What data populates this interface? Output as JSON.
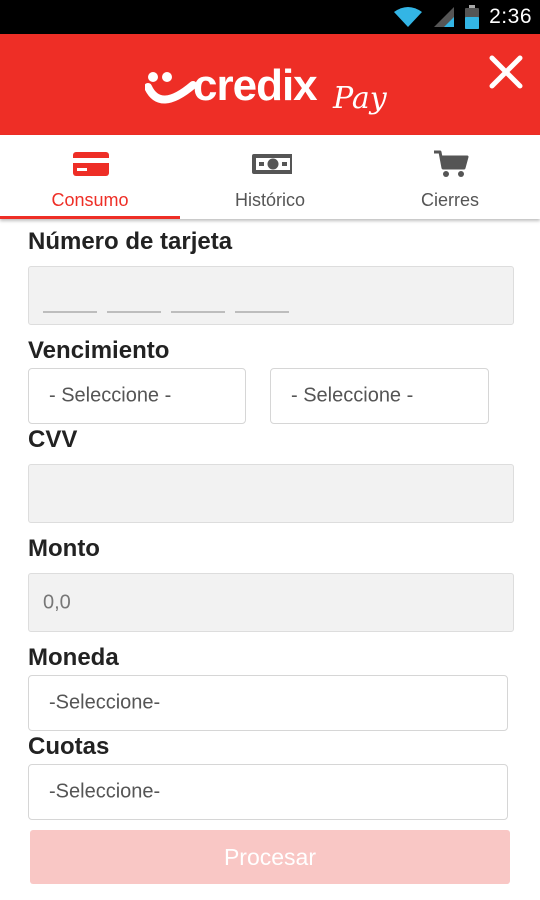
{
  "status_bar": {
    "time": "2:36",
    "icons": [
      "wifi-icon",
      "signal-icon",
      "battery-icon"
    ]
  },
  "app_bar": {
    "logo_text": "credix",
    "logo_sub": "Pay",
    "close_icon": "close-icon",
    "color": "#ee2e26"
  },
  "tabs": [
    {
      "label": "Consumo",
      "icon": "credit-card-icon",
      "active": true
    },
    {
      "label": "Histórico",
      "icon": "money-icon",
      "active": false
    },
    {
      "label": "Cierres",
      "icon": "cart-icon",
      "active": false
    }
  ],
  "form": {
    "card_number": {
      "label": "Número de tarjeta"
    },
    "expiry": {
      "label": "Vencimiento",
      "month_value": "- Seleccione -",
      "year_value": "- Seleccione -"
    },
    "cvv": {
      "label": "CVV"
    },
    "amount": {
      "label": "Monto",
      "placeholder": "0,0"
    },
    "currency": {
      "label": "Moneda",
      "value": "-Seleccione-"
    },
    "installments": {
      "label": "Cuotas",
      "value": "-Seleccione-"
    },
    "submit_label": "Procesar"
  },
  "colors": {
    "accent": "#ee2e26",
    "button_disabled": "#f9c7c5"
  }
}
